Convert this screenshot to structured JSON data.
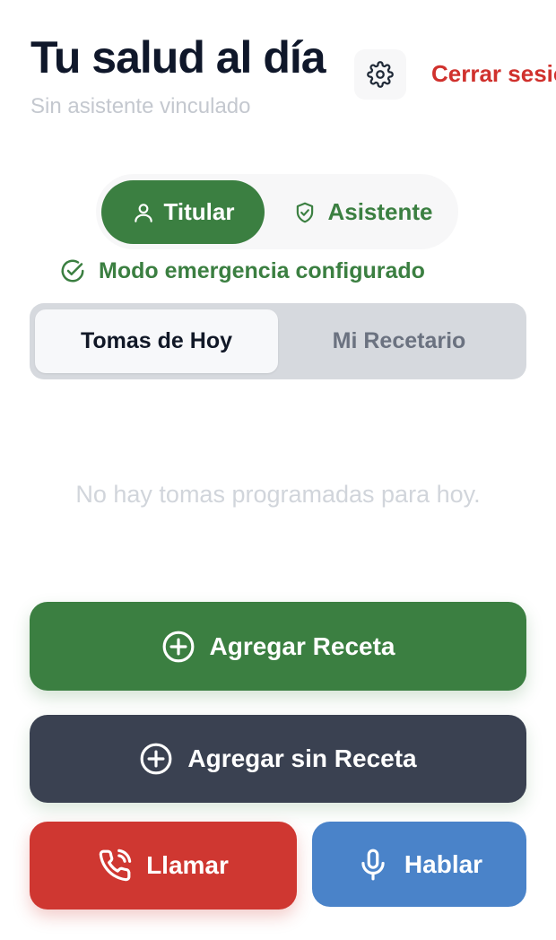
{
  "header": {
    "title": "Tu salud al día",
    "subtitle": "Sin asistente vinculado",
    "logout_label": "Cerrar sesión"
  },
  "roles": {
    "titular_label": "Titular",
    "asistente_label": "Asistente",
    "selected": "Titular"
  },
  "status": {
    "emergency_label": "Modo emergencia configurado"
  },
  "tabs": {
    "items": [
      {
        "label": "Tomas de Hoy",
        "selected": true
      },
      {
        "label": "Mi Recetario",
        "selected": false
      }
    ]
  },
  "main": {
    "empty_message": "No hay tomas programadas para hoy."
  },
  "actions": {
    "add_recipe_label": "Agregar Receta",
    "add_without_recipe_label": "Agregar sin Receta",
    "call_label": "Llamar",
    "talk_label": "Hablar"
  },
  "icons": {
    "settings": "gear-icon",
    "titular": "user-icon",
    "asistente": "shield-check-icon",
    "emergency": "check-circle-icon",
    "add": "plus-circle-icon",
    "call": "phone-icon",
    "talk": "microphone-icon"
  },
  "colors": {
    "primary_green": "#3b7f41",
    "danger_red": "#cf3731",
    "dark_slate": "#3a4151",
    "blue": "#4a83c9",
    "logout_red": "#d0312d"
  }
}
